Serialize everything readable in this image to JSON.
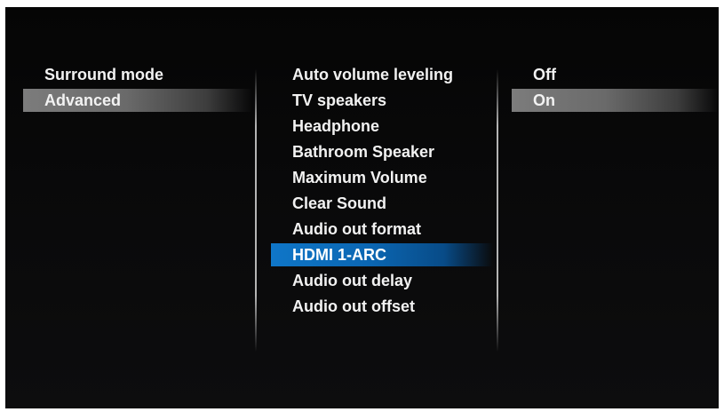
{
  "left_menu": {
    "items": [
      {
        "label": "Surround mode"
      },
      {
        "label": "Advanced"
      }
    ]
  },
  "middle_menu": {
    "items": [
      {
        "label": "Auto volume leveling"
      },
      {
        "label": "TV speakers"
      },
      {
        "label": "Headphone"
      },
      {
        "label": "Bathroom Speaker"
      },
      {
        "label": "Maximum Volume"
      },
      {
        "label": "Clear Sound"
      },
      {
        "label": "Audio out format"
      },
      {
        "label": "HDMI 1-ARC"
      },
      {
        "label": "Audio out delay"
      },
      {
        "label": "Audio out offset"
      }
    ]
  },
  "right_menu": {
    "items": [
      {
        "label": "Off"
      },
      {
        "label": "On"
      }
    ]
  },
  "colors": {
    "focus": "#0b6fc0",
    "selected": "#6e6e6e",
    "text": "#f2f2f2",
    "background": "#070707"
  }
}
